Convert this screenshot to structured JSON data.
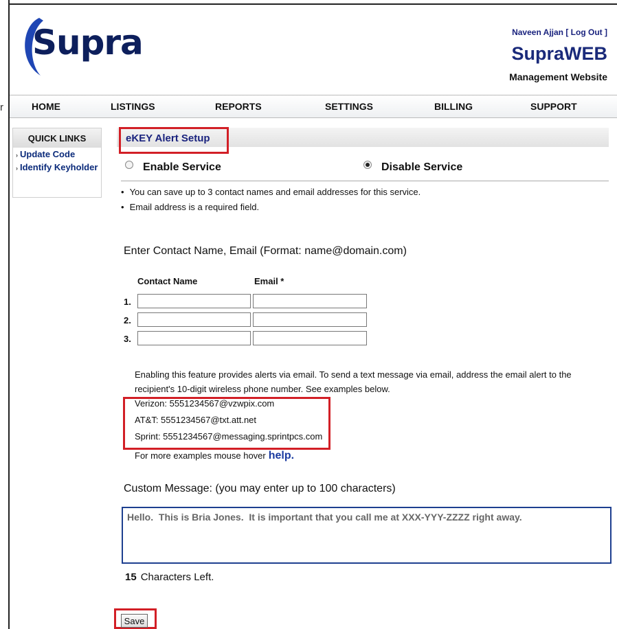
{
  "logo": {
    "text": "Supra"
  },
  "header": {
    "user_name": "Naveen Ajjan",
    "logout": "[ Log Out ]",
    "brand": "SupraWEB",
    "brand_sub": "Management Website",
    "stray_char": "r"
  },
  "nav": {
    "items": [
      "HOME",
      "LISTINGS",
      "REPORTS",
      "SETTINGS",
      "BILLING",
      "SUPPORT"
    ]
  },
  "quick_links": {
    "title": "QUICK LINKS",
    "items": [
      "Update Code",
      "Identify Keyholder"
    ]
  },
  "main": {
    "title": "eKEY Alert Setup",
    "enable_label": "Enable Service",
    "disable_label": "Disable Service",
    "selected_service": "Disable Service",
    "bullets": [
      "You can save up to 3 contact names and email addresses for this service.",
      "Email address is a required field."
    ],
    "enter_label": "Enter Contact Name, Email (Format: name@domain.com)",
    "col_name": "Contact Name",
    "col_email": "Email *",
    "rows": [
      "1.",
      "2.",
      "3."
    ],
    "info_line1": "Enabling this feature provides alerts via email. To send a text message via email, address the email alert to the",
    "info_line2": "recipient's 10-digit wireless phone number. See examples below.",
    "examples": [
      "Verizon: 5551234567@vzwpix.com",
      "AT&T: 5551234567@txt.att.net",
      "Sprint: 5551234567@messaging.sprintpcs.com"
    ],
    "more_examples": "For more examples mouse hover",
    "help": "help.",
    "custom_label": "Custom Message: (you may enter up to 100 characters)",
    "custom_message": "Hello.  This is Bria Jones.  It is important that you call me at XXX-YYY-ZZZZ right away.",
    "chars_left_count": "15",
    "chars_left_text": "Characters Left.",
    "save": "Save"
  },
  "colors": {
    "highlight": "#d21f26",
    "brand": "#1a2a7a",
    "link": "#0a2a7a"
  }
}
